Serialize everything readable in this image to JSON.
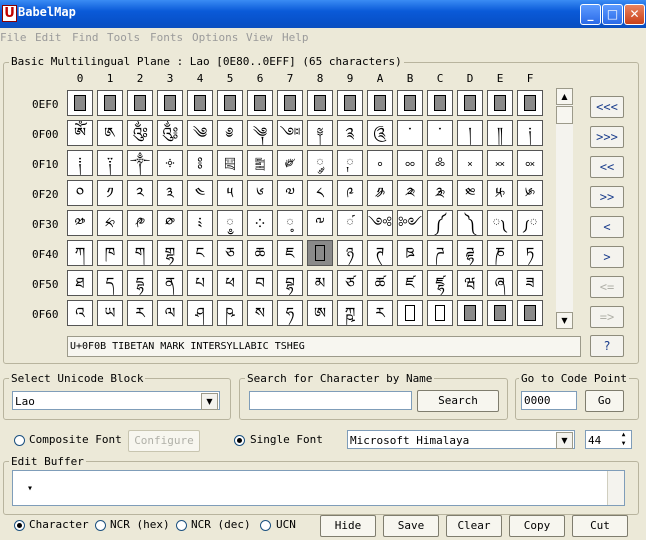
{
  "window": {
    "app_icon_letter": "U",
    "title": "BabelMap",
    "buttons": {
      "minimize": "_",
      "maximize": "□",
      "close": "✕"
    }
  },
  "menu": [
    "File",
    "Edit",
    "Find",
    "Tools",
    "Fonts",
    "Options",
    "View",
    "Help"
  ],
  "grid": {
    "label": "Basic Multilingual Plane : Lao [0E80..0EFF] (65 characters)",
    "columns": [
      "0",
      "1",
      "2",
      "3",
      "4",
      "5",
      "6",
      "7",
      "8",
      "9",
      "A",
      "B",
      "C",
      "D",
      "E",
      "F"
    ],
    "rows": [
      {
        "code": "0EF0",
        "cells": [
          "#",
          "#",
          "#",
          "#",
          "#",
          "#",
          "#",
          "#",
          "#",
          "#",
          "#",
          "#",
          "#",
          "#",
          "#",
          "#"
        ]
      },
      {
        "code": "0F00",
        "cells": [
          "ༀ",
          "༁",
          "༂",
          "༃",
          "༄",
          "༅",
          "༆",
          "༇",
          "༈",
          "༉",
          "༊",
          "་",
          "༌",
          "།",
          "༎",
          "༏"
        ]
      },
      {
        "code": "0F10",
        "cells": [
          "༐",
          "༑",
          "༒",
          "༓",
          "༔",
          "༕",
          "༖",
          "༗",
          "༘",
          "༙",
          "༚",
          "༛",
          "༜",
          "༝",
          "༞",
          "༟"
        ]
      },
      {
        "code": "0F20",
        "cells": [
          "༠",
          "༡",
          "༢",
          "༣",
          "༤",
          "༥",
          "༦",
          "༧",
          "༨",
          "༩",
          "༪",
          "༫",
          "༬",
          "༭",
          "༮",
          "༯"
        ]
      },
      {
        "code": "0F30",
        "cells": [
          "༰",
          "༱",
          "༲",
          "༳",
          "༴",
          "༵",
          "༶",
          "༷",
          "༸",
          "༹",
          "༺",
          "༻",
          "༼",
          "༽",
          "༾",
          "༿"
        ]
      },
      {
        "code": "0F40",
        "cells": [
          "ཀ",
          "ཁ",
          "ག",
          "གྷ",
          "ང",
          "ཅ",
          "ཆ",
          "ཇ",
          "□",
          "ཉ",
          "ཊ",
          "ཋ",
          "ཌ",
          "ཌྷ",
          "ཎ",
          "ཏ"
        ]
      },
      {
        "code": "0F50",
        "cells": [
          "ཐ",
          "ད",
          "དྷ",
          "ན",
          "པ",
          "ཕ",
          "བ",
          "བྷ",
          "མ",
          "ཙ",
          "ཚ",
          "ཛ",
          "ཛྷ",
          "ཝ",
          "ཞ",
          "ཟ"
        ]
      },
      {
        "code": "0F60",
        "cells": [
          "འ",
          "ཡ",
          "ར",
          "ལ",
          "ཤ",
          "ཥ",
          "ས",
          "ཧ",
          "ཨ",
          "ཀྵ",
          "ཪ",
          "□",
          "□",
          "#",
          "#",
          "#"
        ]
      }
    ],
    "status": "U+0F0B TIBETAN MARK INTERSYLLABIC TSHEG"
  },
  "nav_buttons": [
    "<<<",
    ">>>",
    "<<",
    ">>",
    "<",
    ">",
    "<=",
    "=>",
    "?"
  ],
  "scroll": {
    "up": "▲",
    "down": "▼"
  },
  "block_select": {
    "label": "Select Unicode Block",
    "value": "Lao",
    "arrow": "▼"
  },
  "search": {
    "label": "Search for Character by Name",
    "value": "",
    "button": "Search"
  },
  "goto": {
    "label": "Go to Code Point",
    "value": "0000",
    "button": "Go"
  },
  "font": {
    "composite_label": "Composite Font",
    "configure_button": "Configure",
    "single_label": "Single Font",
    "font_name": "Microsoft Himalaya",
    "size": "44",
    "arrow": "▼",
    "spin_up": "▲",
    "spin_down": "▼"
  },
  "edit_buffer": {
    "label": "Edit Buffer",
    "content": "▾"
  },
  "format_options": [
    "Character",
    "NCR (hex)",
    "NCR (dec)",
    "UCN"
  ],
  "actions": [
    "Hide",
    "Save",
    "Clear",
    "Copy",
    "Cut"
  ]
}
